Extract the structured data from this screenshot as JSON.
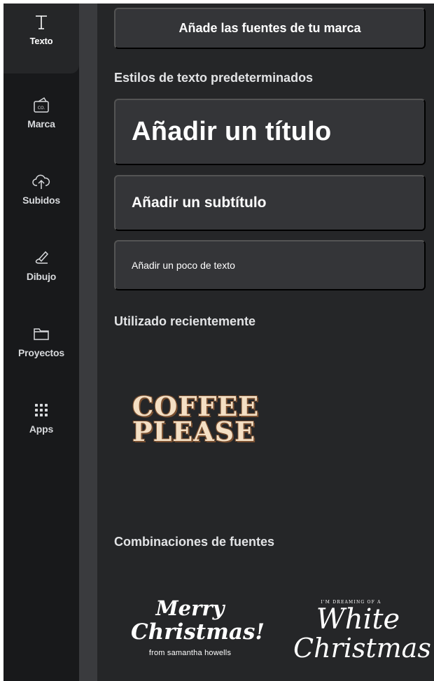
{
  "sidebar": {
    "items": [
      {
        "label": "Texto",
        "icon": "text-icon",
        "active": true
      },
      {
        "label": "Marca",
        "icon": "brand-kit-icon"
      },
      {
        "label": "Subidos",
        "icon": "cloud-upload-icon"
      },
      {
        "label": "Dibujo",
        "icon": "pen-draw-icon"
      },
      {
        "label": "Proyectos",
        "icon": "folder-icon"
      },
      {
        "label": "Apps",
        "icon": "apps-grid-icon"
      }
    ],
    "brand_icon_text": "CO."
  },
  "panel": {
    "brand_fonts_button": "Añade las fuentes de tu marca",
    "default_styles_heading": "Estilos de texto predeterminados",
    "title_button": "Añadir un título",
    "subtitle_button": "Añadir un subtítulo",
    "body_button": "Añadir un poco de texto",
    "recent_heading": "Utilizado recientemente",
    "recent_font": {
      "line1": "COFFEE",
      "line2": "PLEASE"
    },
    "combos_heading": "Combinaciones de fuentes",
    "combos": [
      {
        "line1": "Merry",
        "line2": "Christmas!",
        "line3": "from samantha howells"
      },
      {
        "line1": "I'M DREAMING OF A",
        "line2": "White",
        "line3": "Christmas"
      }
    ]
  },
  "colors": {
    "rail_bg": "#18191b",
    "panel_bg": "#252628",
    "button_bg": "#343538",
    "text": "#ffffff"
  }
}
